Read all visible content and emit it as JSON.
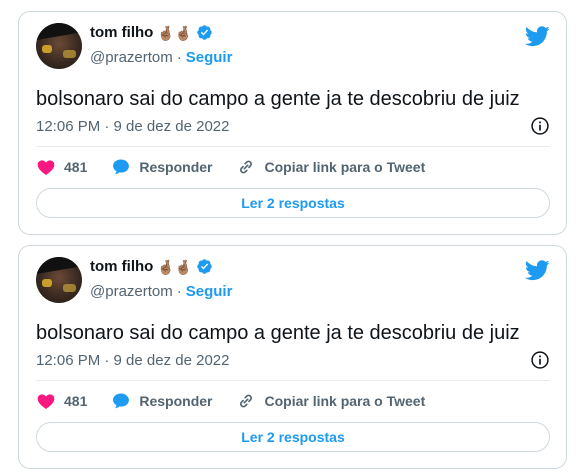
{
  "tweets": [
    {
      "author_name": "tom filho",
      "author_emoji": "🤞🏽🤞🏽",
      "handle": "@prazertom",
      "separator": "·",
      "follow_label": "Seguir",
      "text": "bolsonaro sai do campo a gente ja te descobriu de juiz",
      "timestamp": "12:06 PM · 9 de dez de 2022",
      "like_count": "481",
      "reply_label": "Responder",
      "copy_link_label": "Copiar link para o Tweet",
      "read_replies_label": "Ler 2 respostas"
    },
    {
      "author_name": "tom filho",
      "author_emoji": "🤞🏽🤞🏽",
      "handle": "@prazertom",
      "separator": "·",
      "follow_label": "Seguir",
      "text": "bolsonaro sai do campo a gente ja te descobriu de juiz",
      "timestamp": "12:06 PM · 9 de dez de 2022",
      "like_count": "481",
      "reply_label": "Responder",
      "copy_link_label": "Copiar link para o Tweet",
      "read_replies_label": "Ler 2 respostas"
    }
  ],
  "icons": {
    "verified": "verified-badge-icon",
    "logo": "twitter-bird-icon",
    "info": "info-circle-icon",
    "like": "heart-icon",
    "reply": "speech-bubble-icon",
    "copy_link": "link-icon"
  },
  "colors": {
    "accent": "#1d9bf0",
    "like": "#f91880",
    "text": "#0f1419",
    "muted": "#536471",
    "border": "#cfd9de"
  }
}
